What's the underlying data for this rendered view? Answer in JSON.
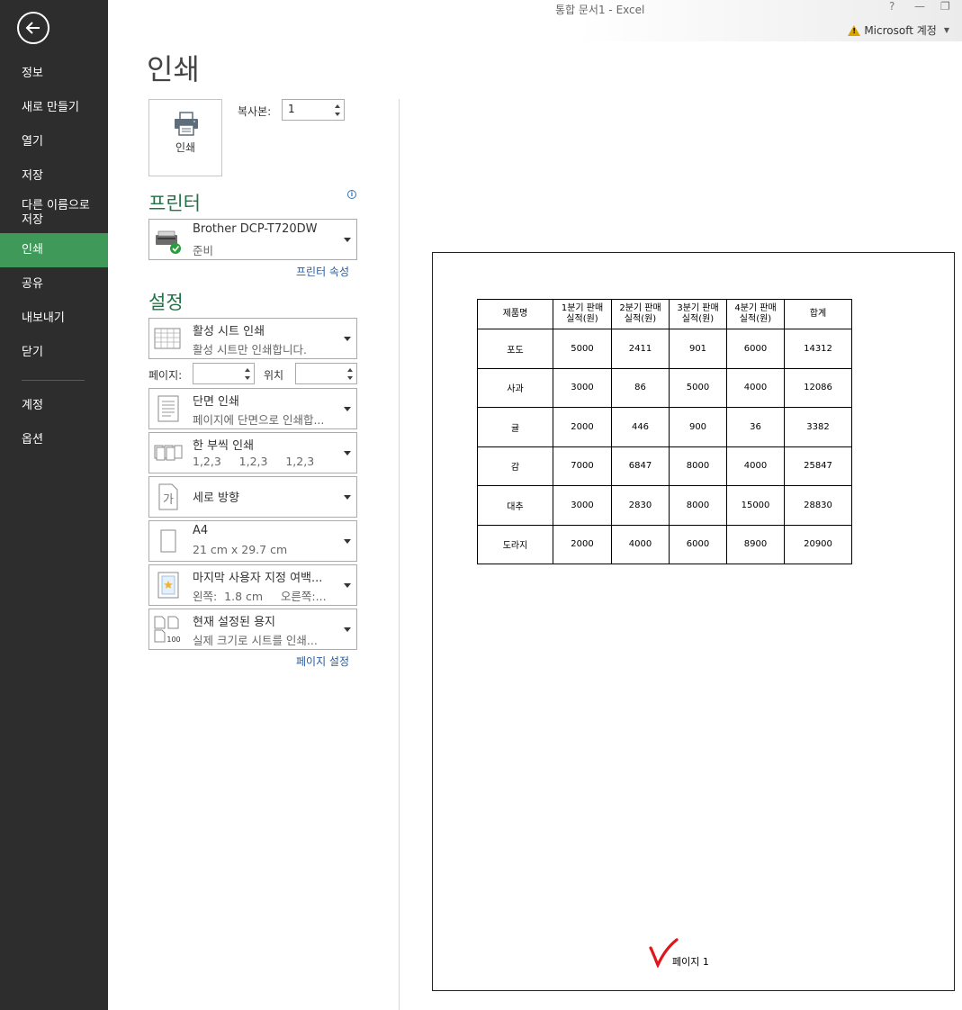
{
  "window": {
    "title": "통합 문서1 - Excel",
    "help": "?",
    "minimize": "—",
    "restore": "❐",
    "account": "Microsoft 계정"
  },
  "sidebar": {
    "items": [
      {
        "label": "정보"
      },
      {
        "label": "새로 만들기"
      },
      {
        "label": "열기"
      },
      {
        "label": "저장"
      },
      {
        "label": "다른 이름으로\n저장"
      },
      {
        "label": "인쇄",
        "active": true
      },
      {
        "label": "공유"
      },
      {
        "label": "내보내기"
      },
      {
        "label": "닫기"
      },
      {
        "label": "계정"
      },
      {
        "label": "옵션"
      }
    ]
  },
  "print": {
    "heading": "인쇄",
    "button_label": "인쇄",
    "copies_label": "복사본:",
    "copies_value": "1"
  },
  "printer": {
    "heading": "프린터",
    "info": "i",
    "name": "Brother DCP-T720DW",
    "status": "준비",
    "properties_link": "프린터 속성"
  },
  "settings": {
    "heading": "설정",
    "what": {
      "title": "활성 시트 인쇄",
      "sub": "활성 시트만 인쇄합니다."
    },
    "pages_label": "페이지:",
    "to_label": "위치",
    "sides": {
      "title": "단면 인쇄",
      "sub": "페이지에 단면으로 인쇄합..."
    },
    "collate": {
      "title": "한 부씩 인쇄",
      "sub": "1,2,3     1,2,3     1,2,3"
    },
    "orientation": {
      "title": "세로 방향"
    },
    "paper": {
      "title": "A4",
      "sub": "21 cm x 29.7 cm"
    },
    "margins": {
      "title": "마지막 사용자 지정 여백...",
      "sub": "왼쪽:  1.8 cm     오른쪽:..."
    },
    "scaling": {
      "title": "현재 설정된 용지",
      "sub": "실제 크기로 시트를 인쇄..."
    },
    "page_setup_link": "페이지 설정",
    "orientation_glyph": "가",
    "scaling_glyph": "100"
  },
  "preview": {
    "headers": [
      "제품명",
      "1분기 판매\n실적(원)",
      "2분기 판매\n실적(원)",
      "3분기 판매\n실적(원)",
      "4분기 판매\n실적(원)",
      "합계"
    ],
    "rows": [
      [
        "포도",
        "5000",
        "2411",
        "901",
        "6000",
        "14312"
      ],
      [
        "사과",
        "3000",
        "86",
        "5000",
        "4000",
        "12086"
      ],
      [
        "귤",
        "2000",
        "446",
        "900",
        "36",
        "3382"
      ],
      [
        "감",
        "7000",
        "6847",
        "8000",
        "4000",
        "25847"
      ],
      [
        "대추",
        "3000",
        "2830",
        "8000",
        "15000",
        "28830"
      ],
      [
        "도라지",
        "2000",
        "4000",
        "6000",
        "8900",
        "20900"
      ]
    ],
    "page_label": "페이지 1"
  }
}
